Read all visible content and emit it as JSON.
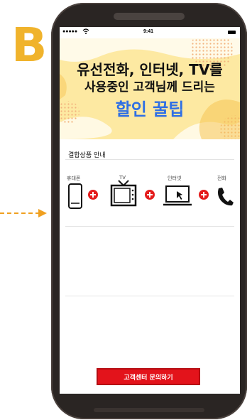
{
  "marker": {
    "letter": "B",
    "color": "#f0b32c"
  },
  "arrow": {
    "color": "#f0a020"
  },
  "status_bar": {
    "signal": "●●●●● ",
    "time": "9:41"
  },
  "hero": {
    "line1": "유선전화, 인터넷, TV를",
    "line2": "사용중인 고객님께 드리는",
    "line3": "할인 꿀팁",
    "accent_color": "#2f6fe4",
    "background_color": "#fde9a2"
  },
  "bundle": {
    "title": "결합상품 안내",
    "items": [
      {
        "label": "휴대폰",
        "icon": "mobile-phone-icon"
      },
      {
        "label": "TV",
        "icon": "tv-icon"
      },
      {
        "label": "인터넷",
        "icon": "laptop-icon"
      },
      {
        "label": "전화",
        "icon": "telephone-icon"
      }
    ],
    "plus_color": "#e41c1c"
  },
  "cta": {
    "label": "고객센터 문의하기",
    "color": "#e3131b"
  }
}
